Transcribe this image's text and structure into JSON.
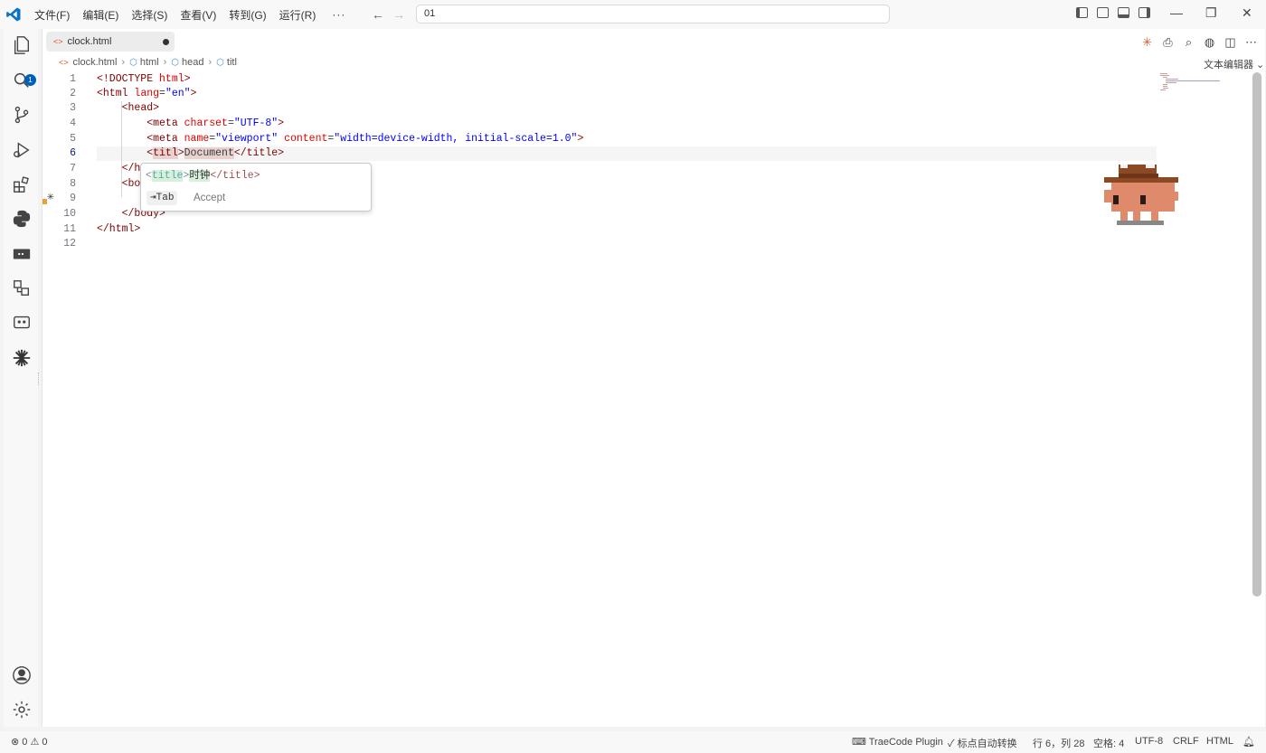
{
  "menu": [
    "文件(F)",
    "编辑(E)",
    "选择(S)",
    "查看(V)",
    "转到(G)",
    "运行(R)"
  ],
  "menu_more": "···",
  "search": {
    "value": "01"
  },
  "activity": {
    "explorer_badge": "1"
  },
  "tab": {
    "filename": "clock.html"
  },
  "breadcrumb": [
    "clock.html",
    "html",
    "head",
    "titl"
  ],
  "editor_mode": "文本编辑器",
  "code": {
    "line_numbers": [
      "1",
      "2",
      "3",
      "4",
      "5",
      "6",
      "7",
      "8",
      "9",
      "10",
      "11",
      "12"
    ],
    "current_line": "6"
  },
  "suggestion": {
    "open": "<",
    "tag": "title",
    "close_open": ">",
    "text": "时钟",
    "end": "</title>",
    "key": "⇥Tab",
    "accept": "Accept"
  },
  "status": {
    "errors": "0",
    "warnings": "0",
    "plugin": "TraeCode Plugin",
    "autoconvert": "标点自动转换",
    "position": "行 6，列 28",
    "spaces": "空格: 4",
    "encoding": "UTF-8",
    "eol": "CRLF",
    "language": "HTML"
  },
  "colors": {
    "accent": "#005fb8",
    "tag": "#800000",
    "attr": "#e50000",
    "string": "#0000ff"
  }
}
